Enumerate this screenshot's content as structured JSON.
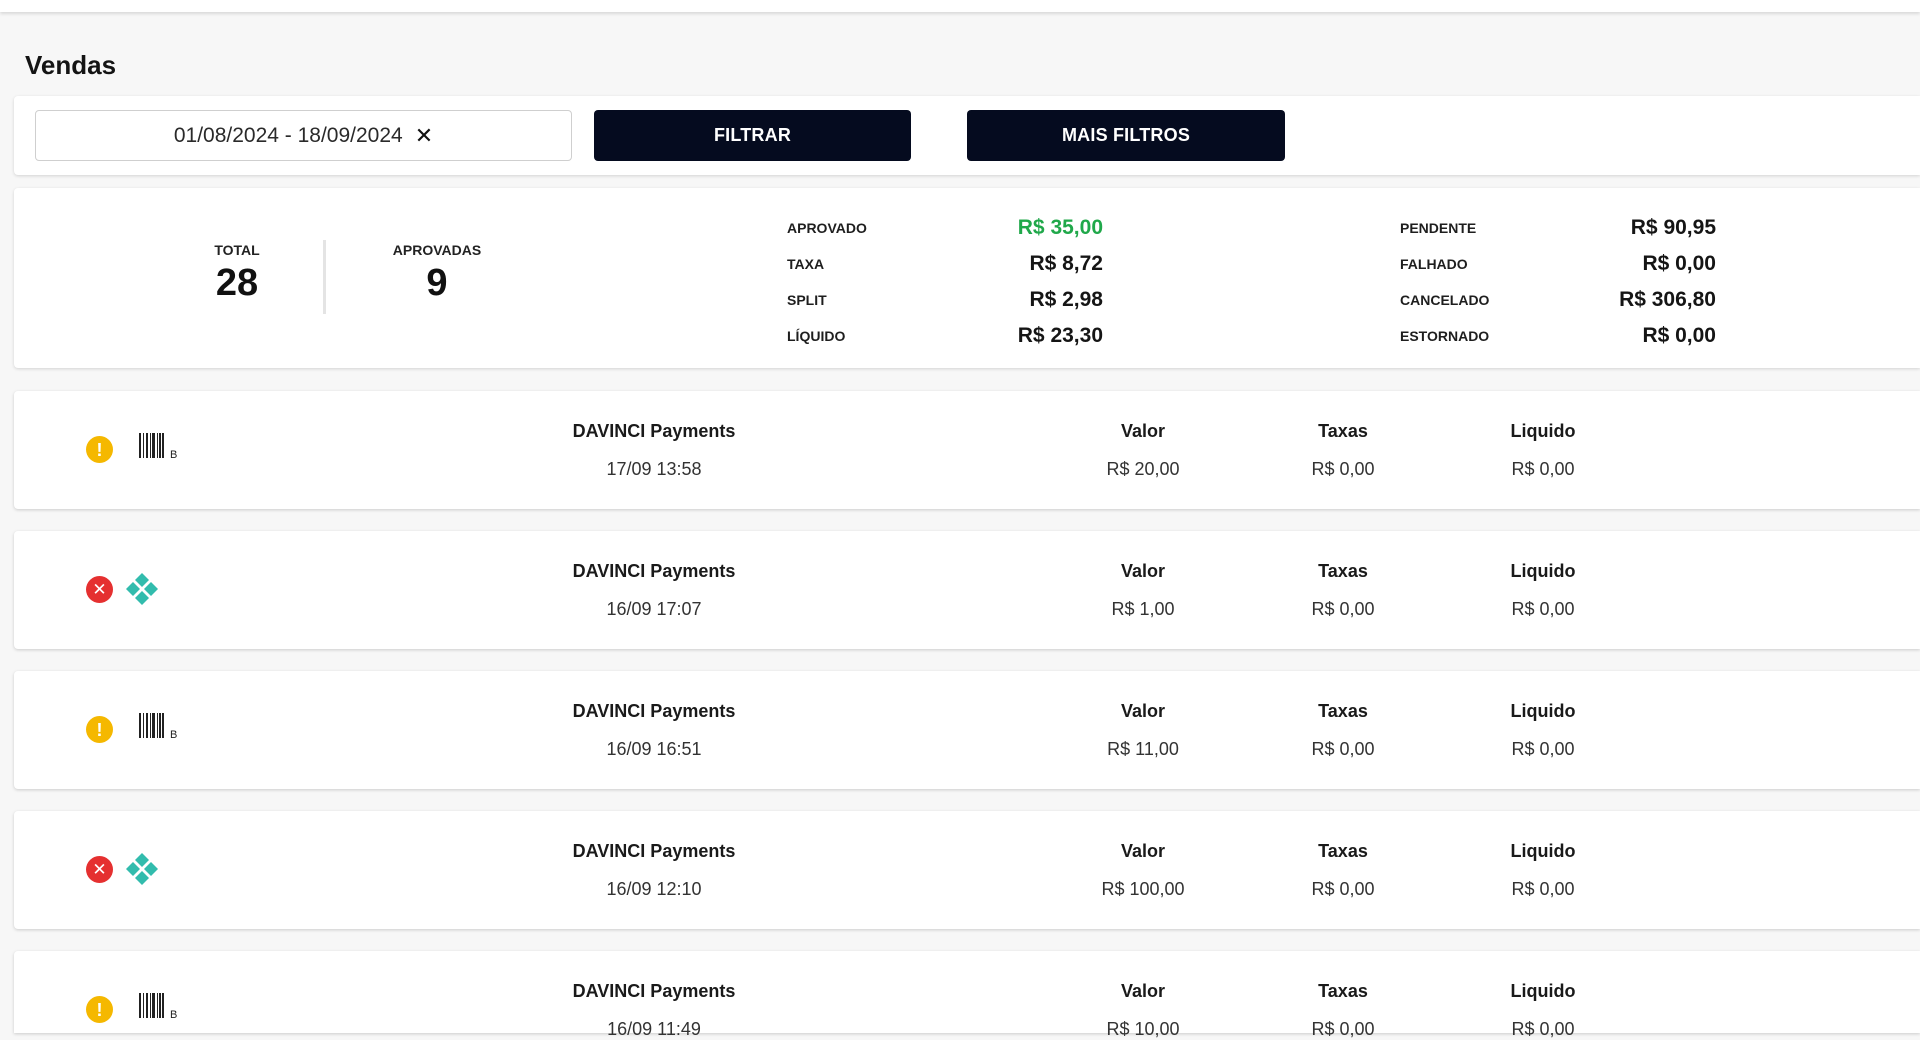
{
  "page": {
    "title": "Vendas"
  },
  "filters": {
    "date_range": "01/08/2024 - 18/09/2024",
    "clear_label": "✕",
    "filter_button": "FILTRAR",
    "more_filters_button": "MAIS FILTROS"
  },
  "summary": {
    "total": {
      "label": "TOTAL",
      "value": "28"
    },
    "approved": {
      "label": "APROVADAS",
      "value": "9"
    },
    "col1": [
      {
        "label": "APROVADO",
        "value": "R$ 35,00",
        "color": "#20a84a"
      },
      {
        "label": "TAXA",
        "value": "R$ 8,72"
      },
      {
        "label": "SPLIT",
        "value": "R$ 2,98"
      },
      {
        "label": "LÍQUIDO",
        "value": "R$ 23,30"
      }
    ],
    "col2": [
      {
        "label": "PENDENTE",
        "value": "R$ 90,95"
      },
      {
        "label": "FALHADO",
        "value": "R$ 0,00"
      },
      {
        "label": "CANCELADO",
        "value": "R$ 306,80"
      },
      {
        "label": "ESTORNADO",
        "value": "R$ 0,00"
      }
    ]
  },
  "columns": {
    "valor": "Valor",
    "taxas": "Taxas",
    "liquido": "Liquido"
  },
  "transactions": [
    {
      "status": "warning-icon",
      "method": "boleto-icon",
      "method_letter": "B",
      "merchant": "DAVINCI Payments",
      "date": "17/09 13:58",
      "valor": "R$ 20,00",
      "taxas": "R$ 0,00",
      "liquido": "R$ 0,00"
    },
    {
      "status": "error-icon",
      "method": "pix-icon",
      "merchant": "DAVINCI Payments",
      "date": "16/09 17:07",
      "valor": "R$ 1,00",
      "taxas": "R$ 0,00",
      "liquido": "R$ 0,00"
    },
    {
      "status": "warning-icon",
      "method": "boleto-icon",
      "method_letter": "B",
      "merchant": "DAVINCI Payments",
      "date": "16/09 16:51",
      "valor": "R$ 11,00",
      "taxas": "R$ 0,00",
      "liquido": "R$ 0,00"
    },
    {
      "status": "error-icon",
      "method": "pix-icon",
      "merchant": "DAVINCI Payments",
      "date": "16/09 12:10",
      "valor": "R$ 100,00",
      "taxas": "R$ 0,00",
      "liquido": "R$ 0,00"
    },
    {
      "status": "warning-icon",
      "method": "boleto-icon",
      "method_letter": "B",
      "merchant": "DAVINCI Payments",
      "date": "16/09 11:49",
      "valor": "R$ 10,00",
      "taxas": "R$ 0,00",
      "liquido": "R$ 0,00"
    }
  ],
  "colors": {
    "button_bg": "#050b1f",
    "warning": "#f5b800",
    "error": "#e53030",
    "pix": "#32bcad",
    "approved": "#20a84a"
  }
}
